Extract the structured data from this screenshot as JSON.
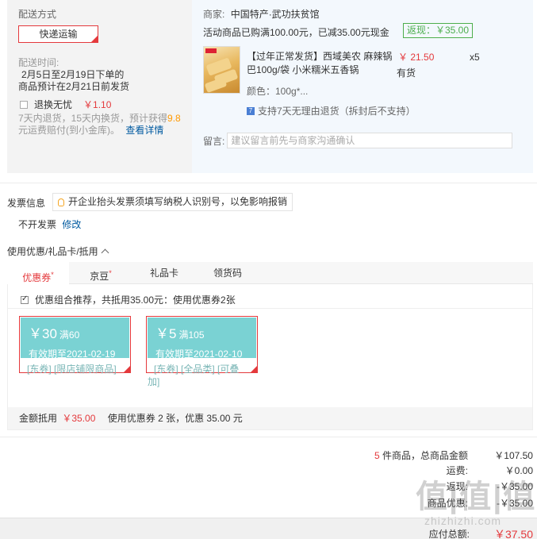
{
  "shipping": {
    "title": "配送方式",
    "option": "快递运输",
    "time_label": "配送时间:",
    "time_line1": "2月5日至2月19日下单的",
    "time_line2": "商品预计在2月21日前发货",
    "return_label": "退换无忧",
    "return_price": "￥1.10",
    "return_desc_a": "7天内退货，15天内换货，预计获得",
    "return_desc_points": "9.8",
    "return_desc_b": "元运费赔付(到小金库)。",
    "return_link": "查看详情"
  },
  "shop": {
    "seller_label": "商家:",
    "seller_name": "中国特产·武功扶贫馆",
    "promo": "活动商品已购满100.00元，已减35.00元现金",
    "rebate": "返现：￥35.00",
    "product_name": "【过年正常发货】西域美农 麻辣锅巴100g/袋 小米糯米五香锅",
    "product_price": "￥ 21.50",
    "product_qty": "x5",
    "product_stock": "有货",
    "product_color": "颜色：100g*...",
    "refund_icon": "7",
    "refund_text": "支持7天无理由退货（拆封后不支持）",
    "memo_label": "留言:",
    "memo_placeholder": "建议留言前先与商家沟通确认"
  },
  "invoice": {
    "title": "发票信息",
    "tip": "开企业抬头发票须填写纳税人识别号，以免影响报销",
    "status": "不开发票",
    "edit": "修改"
  },
  "coupons": {
    "title": "使用优惠/礼品卡/抵用",
    "tabs": [
      {
        "label": "优惠券",
        "mark": "*"
      },
      {
        "label": "京豆",
        "mark": "*"
      },
      {
        "label": "礼品卡",
        "mark": ""
      },
      {
        "label": "领货码",
        "mark": ""
      }
    ],
    "combo_text": "优惠组合推荐，共抵用35.00元：使用优惠券2张",
    "items": [
      {
        "amount": "￥30",
        "condition": "满60",
        "expiry": "有效期至2021-02-19",
        "scope": "[东券] [限店铺限商品]",
        "scope_overflow": ""
      },
      {
        "amount": "￥5",
        "condition": "满105",
        "expiry": "有效期至2021-02-10",
        "scope": "[东券] [全品类] [可叠",
        "scope_overflow": "加]"
      }
    ],
    "total_label": "金额抵用",
    "total_amount": "￥35.00",
    "total_desc": "使用优惠券 2 张，优惠 35.00 元"
  },
  "summary": {
    "count": "5",
    "count_label": "件商品，总商品金额",
    "goods_total": "￥107.50",
    "shipping_label": "运费:",
    "shipping_fee": "￥0.00",
    "rebate_label": "返现:",
    "rebate_amount": "-￥35.00",
    "coupon_label": "商品优惠:",
    "coupon_amount": "-￥35.00",
    "payable_label": "应付总额:",
    "payable_amount": "￥37.50"
  },
  "watermark": {
    "main": "值|值|值",
    "sub": "zhizhizhi.com"
  },
  "colors": {
    "accent": "#e4393c",
    "coupon": "#7ad2d3",
    "rebate": "#4cae4c",
    "link": "#005aa0"
  }
}
